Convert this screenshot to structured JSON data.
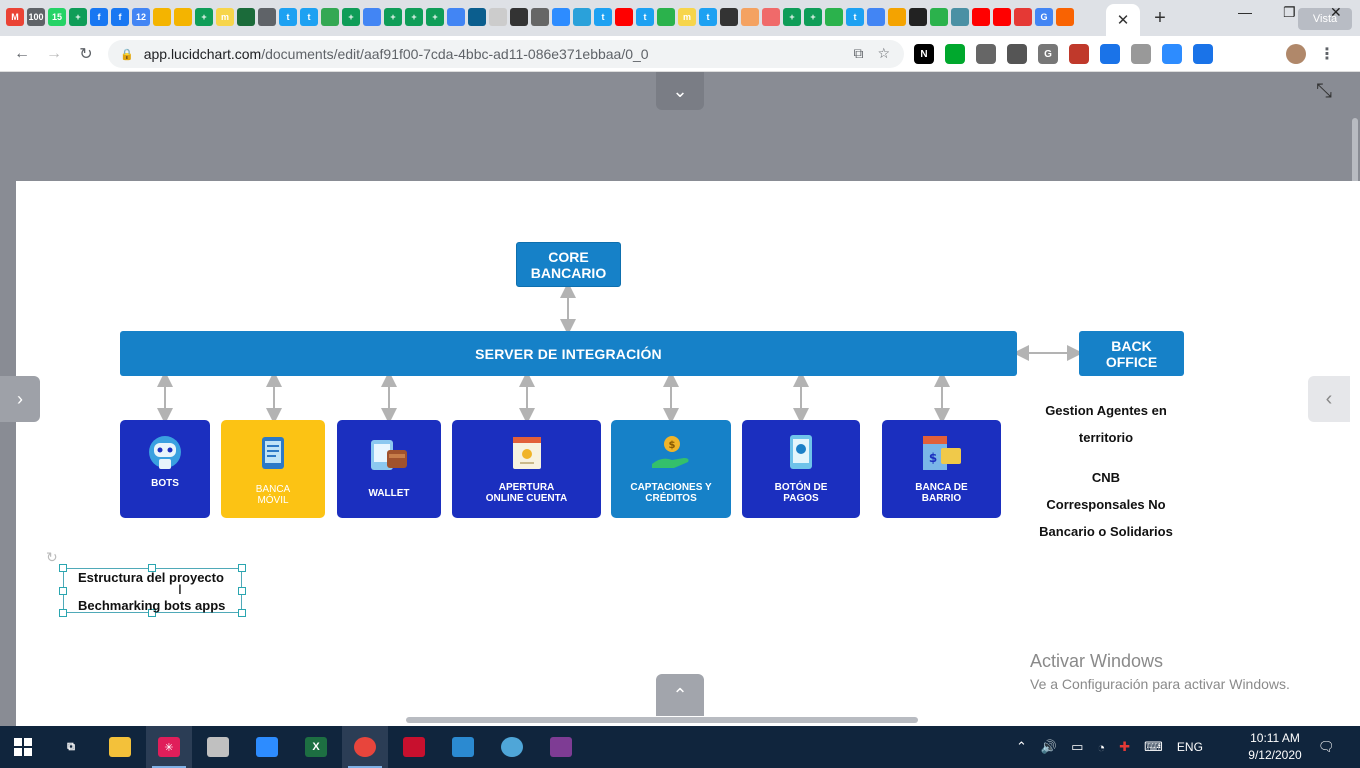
{
  "browser": {
    "tab_favicons": [
      {
        "name": "gmail-icon",
        "glyph": "M",
        "color": "#ea4335"
      },
      {
        "name": "gmail-count-icon",
        "glyph": "100",
        "color": "#5f6368"
      },
      {
        "name": "whatsapp-icon",
        "glyph": "15",
        "color": "#25d366"
      },
      {
        "name": "sheets-icon",
        "glyph": "+",
        "color": "#0f9d58"
      },
      {
        "name": "facebook-icon",
        "glyph": "f",
        "color": "#1877f2"
      },
      {
        "name": "facebook-icon",
        "glyph": "f",
        "color": "#1877f2"
      },
      {
        "name": "calendar-icon",
        "glyph": "12",
        "color": "#4285f4"
      },
      {
        "name": "slides-icon",
        "glyph": "",
        "color": "#f4b400"
      },
      {
        "name": "slides-icon",
        "glyph": "",
        "color": "#f4b400"
      },
      {
        "name": "sheets-icon",
        "glyph": "+",
        "color": "#0f9d58"
      },
      {
        "name": "miro-icon",
        "glyph": "m",
        "color": "#f7d54b"
      },
      {
        "name": "sheets-icon",
        "glyph": "",
        "color": "#1b6b3a"
      },
      {
        "name": "web-icon",
        "glyph": "",
        "color": "#5f6368"
      },
      {
        "name": "twitter-icon",
        "glyph": "t",
        "color": "#1da1f2"
      },
      {
        "name": "twitter-icon",
        "glyph": "t",
        "color": "#1da1f2"
      },
      {
        "name": "drive-icon",
        "glyph": "",
        "color": "#34a853"
      },
      {
        "name": "sheets-icon",
        "glyph": "+",
        "color": "#0f9d58"
      },
      {
        "name": "docs-icon",
        "glyph": "",
        "color": "#4285f4"
      },
      {
        "name": "sheets-icon",
        "glyph": "+",
        "color": "#0f9d58"
      },
      {
        "name": "sheets-icon",
        "glyph": "+",
        "color": "#0f9d58"
      },
      {
        "name": "sheets-icon",
        "glyph": "+",
        "color": "#0f9d58"
      },
      {
        "name": "docs-icon",
        "glyph": "",
        "color": "#4285f4"
      },
      {
        "name": "web-icon",
        "glyph": "",
        "color": "#0b5e8e"
      },
      {
        "name": "cloud-icon",
        "glyph": "",
        "color": "#cccccc"
      },
      {
        "name": "web-icon",
        "glyph": "",
        "color": "#333333"
      },
      {
        "name": "web-icon",
        "glyph": "",
        "color": "#666666"
      },
      {
        "name": "zoom-icon",
        "glyph": "",
        "color": "#2d8cff"
      },
      {
        "name": "telegram-icon",
        "glyph": "",
        "color": "#2aa1da"
      },
      {
        "name": "twitter-icon",
        "glyph": "t",
        "color": "#1da1f2"
      },
      {
        "name": "youtube-icon",
        "glyph": "",
        "color": "#ff0000"
      },
      {
        "name": "twitter-icon",
        "glyph": "t",
        "color": "#1da1f2"
      },
      {
        "name": "feedly-icon",
        "glyph": "",
        "color": "#2bb24c"
      },
      {
        "name": "miro-icon",
        "glyph": "m",
        "color": "#f7d54b"
      },
      {
        "name": "twitter-icon",
        "glyph": "t",
        "color": "#1da1f2"
      },
      {
        "name": "web-icon",
        "glyph": "",
        "color": "#333333"
      },
      {
        "name": "pencil-icon",
        "glyph": "",
        "color": "#f4a261"
      },
      {
        "name": "asana-icon",
        "glyph": "",
        "color": "#f06a6a"
      },
      {
        "name": "sheets-icon",
        "glyph": "+",
        "color": "#0f9d58"
      },
      {
        "name": "sheets-icon",
        "glyph": "+",
        "color": "#0f9d58"
      },
      {
        "name": "feedly-icon",
        "glyph": "",
        "color": "#2bb24c"
      },
      {
        "name": "twitter-icon",
        "glyph": "t",
        "color": "#1da1f2"
      },
      {
        "name": "docs-icon",
        "glyph": "",
        "color": "#4285f4"
      },
      {
        "name": "key-icon",
        "glyph": "",
        "color": "#f4a300"
      },
      {
        "name": "web-icon",
        "glyph": "",
        "color": "#222222"
      },
      {
        "name": "feedly-icon",
        "glyph": "",
        "color": "#2bb24c"
      },
      {
        "name": "web-icon",
        "glyph": "",
        "color": "#4a90a4"
      },
      {
        "name": "youtube-icon",
        "glyph": "",
        "color": "#ff0000"
      },
      {
        "name": "youtube-icon",
        "glyph": "",
        "color": "#ff0000"
      },
      {
        "name": "web-icon",
        "glyph": "",
        "color": "#e53935"
      },
      {
        "name": "google-icon",
        "glyph": "G",
        "color": "#4285f4"
      },
      {
        "name": "web-icon",
        "glyph": "",
        "color": "#f96302"
      }
    ],
    "active_tab_close": "✕",
    "new_tab": "+",
    "window_controls": {
      "minimize": "—",
      "maximize": "❐",
      "close": "✕"
    },
    "vista_label": "Vista",
    "url_host": "app.lucidchart.com",
    "url_path": "/documents/edit/aaf91f00-7cda-4bbc-ad11-086e371ebbaa/0_0",
    "extensions": [
      {
        "name": "notion-icon",
        "glyph": "N",
        "color": "#000000"
      },
      {
        "name": "evernote-icon",
        "glyph": "",
        "color": "#00a82d"
      },
      {
        "name": "drive-icon",
        "glyph": "",
        "color": "#666666"
      },
      {
        "name": "web-icon",
        "glyph": "",
        "color": "#555555"
      },
      {
        "name": "google-icon",
        "glyph": "G",
        "color": "#777777"
      },
      {
        "name": "pdf-icon",
        "glyph": "",
        "color": "#c0392b"
      },
      {
        "name": "translate-icon",
        "glyph": "",
        "color": "#1a73e8"
      },
      {
        "name": "gear-icon",
        "glyph": "",
        "color": "#999999"
      },
      {
        "name": "zoom-icon",
        "glyph": "",
        "color": "#2d8cff"
      },
      {
        "name": "pen-icon",
        "glyph": "",
        "color": "#1a73e8"
      },
      {
        "name": "puzzle-icon",
        "glyph": "",
        "color": "#5f6368"
      },
      {
        "name": "cast-icon",
        "glyph": "",
        "color": "#5f6368"
      },
      {
        "name": "avatar-icon",
        "glyph": "",
        "color": "#b0886a"
      },
      {
        "name": "menu-icon",
        "glyph": "⋮",
        "color": "#5f6368"
      }
    ]
  },
  "diagram": {
    "core": "CORE\nBANCARIO",
    "server": "SERVER DE INTEGRACIÓN",
    "backoffice": "BACK\nOFFICE",
    "cards": [
      {
        "label": "BOTS",
        "color": "#1b2fbf",
        "icon": "robot-icon"
      },
      {
        "label": "BANCA\nMÓVIL",
        "color": "#fcc314",
        "icon": "phone-icon"
      },
      {
        "label": "WALLET",
        "color": "#1b2fbf",
        "icon": "wallet-icon"
      },
      {
        "label": "APERTURA\nONLINE CUENTA",
        "color": "#1b2fbf",
        "icon": "document-icon"
      },
      {
        "label": "CAPTACIONES Y\nCRÉDITOS",
        "color": "#1681c8",
        "icon": "hand-money-icon"
      },
      {
        "label": "BOTÓN DE\nPAGOS",
        "color": "#1b2fbf",
        "icon": "payment-phone-icon"
      },
      {
        "label": "BANCA DE\nBARRIO",
        "color": "#1b2fbf",
        "icon": "store-icon"
      }
    ],
    "side_notes": {
      "gestion_1": "Gestion Agentes en",
      "gestion_2": "territorio",
      "cnb": "CNB",
      "corr_1": "Corresponsales No",
      "corr_2": "Bancario o Solidarios"
    },
    "selected_text": {
      "line1": "Estructura del proyecto",
      "line2": "Bechmarking bots apps"
    },
    "colors": {
      "primary": "#1681c8",
      "card_blue": "#1b2fbf",
      "card_yellow": "#fcc314",
      "arrow": "#b3b3b3"
    }
  },
  "watermark": {
    "title": "Activar Windows",
    "subtitle": "Ve a Configuración para activar Windows."
  },
  "taskbar": {
    "apps": [
      {
        "name": "task-view-icon",
        "glyph": "⧉",
        "color": "#ffffff",
        "active": false
      },
      {
        "name": "file-explorer-icon",
        "glyph": "",
        "color": "#f3c13a",
        "active": false
      },
      {
        "name": "slack-icon",
        "glyph": "✳",
        "color": "#e01e5a",
        "active": true
      },
      {
        "name": "paint-icon",
        "glyph": "",
        "color": "#c0c0c0",
        "active": false
      },
      {
        "name": "zoom-icon",
        "glyph": "",
        "color": "#2d8cff",
        "active": false
      },
      {
        "name": "excel-icon",
        "glyph": "X",
        "color": "#1d6f42",
        "active": false
      },
      {
        "name": "chrome-icon",
        "glyph": "",
        "color": "#e8453c",
        "active": true
      },
      {
        "name": "acrobat-icon",
        "glyph": "",
        "color": "#c8102e",
        "active": false
      },
      {
        "name": "photos-icon",
        "glyph": "",
        "color": "#2b8ad1",
        "active": false
      },
      {
        "name": "browser-icon",
        "glyph": "",
        "color": "#4fa6d8",
        "active": false
      },
      {
        "name": "winrar-icon",
        "glyph": "",
        "color": "#7e3c94",
        "active": false
      }
    ],
    "language": "ENG",
    "time": "10:11 AM",
    "date": "9/12/2020"
  }
}
